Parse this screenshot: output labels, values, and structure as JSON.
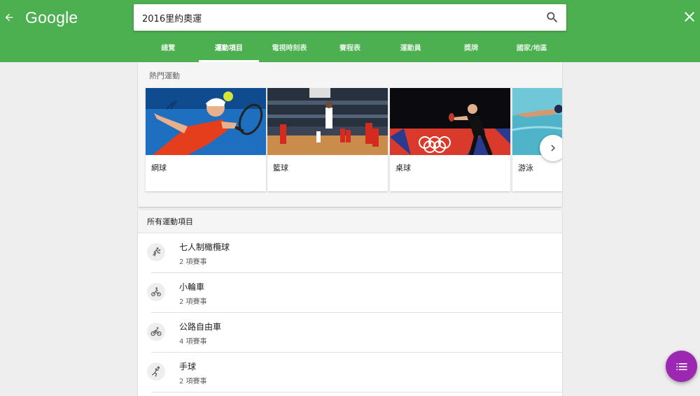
{
  "header": {
    "logo": "Google",
    "search_value": "2016里約奧運",
    "bg_color": "#4caf50"
  },
  "tabs": [
    {
      "label": "總覽",
      "active": false
    },
    {
      "label": "運動項目",
      "active": true
    },
    {
      "label": "電視時刻表",
      "active": false
    },
    {
      "label": "賽程表",
      "active": false
    },
    {
      "label": "運動員",
      "active": false
    },
    {
      "label": "獎牌",
      "active": false
    },
    {
      "label": "國家/地區",
      "active": false
    }
  ],
  "popular": {
    "title": "熱門運動",
    "cards": [
      {
        "label": "網球",
        "image": "tennis-player-photo"
      },
      {
        "label": "籃球",
        "image": "basketball-game-photo"
      },
      {
        "label": "桌球",
        "image": "table-tennis-player-photo"
      },
      {
        "label": "游泳",
        "image": "swimmer-photo"
      }
    ],
    "next_icon": "chevron-right-icon"
  },
  "all_sports": {
    "title": "所有運動項目",
    "items": [
      {
        "name": "七人制橄欖球",
        "count": "2 項賽事",
        "icon": "rugby-icon"
      },
      {
        "name": "小輪車",
        "count": "2 項賽事",
        "icon": "bmx-icon"
      },
      {
        "name": "公路自由車",
        "count": "4 項賽事",
        "icon": "road-cycling-icon"
      },
      {
        "name": "手球",
        "count": "2 項賽事",
        "icon": "handball-icon"
      }
    ]
  },
  "fab": {
    "icon": "list-icon",
    "color": "#9c27b0"
  }
}
